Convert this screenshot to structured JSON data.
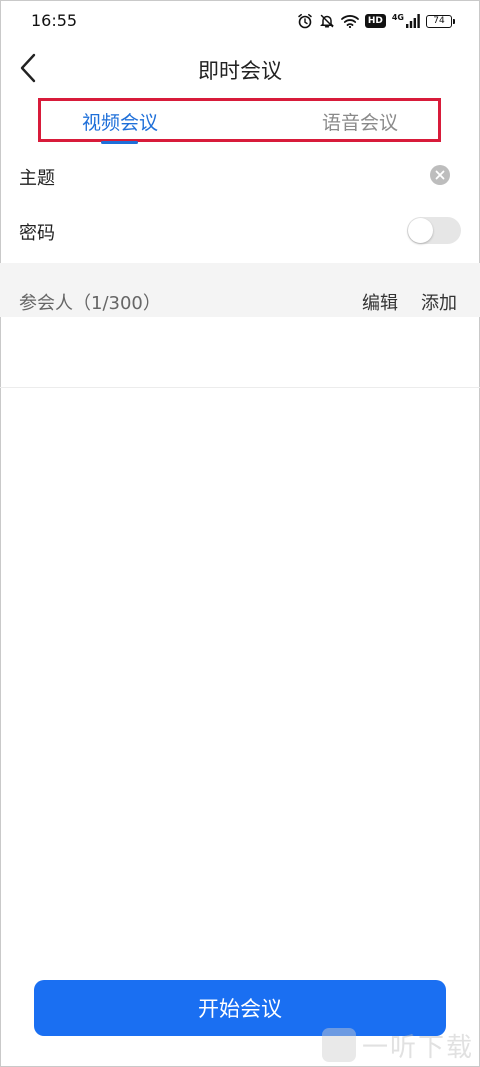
{
  "status_bar": {
    "time": "16:55",
    "hd_label": "HD",
    "network_label": "4G",
    "battery_level": "74",
    "icons": [
      "alarm-icon",
      "bell-off-icon",
      "wifi-icon",
      "hd-icon",
      "signal-icon",
      "battery-icon"
    ]
  },
  "header": {
    "title": "即时会议",
    "back_icon": "chevron-left-icon"
  },
  "tabs": [
    {
      "label": "视频会议",
      "active": true
    },
    {
      "label": "语音会议",
      "active": false
    }
  ],
  "form": {
    "subject_label": "主题",
    "subject_value": "",
    "password_label": "密码",
    "password_enabled": false
  },
  "participants": {
    "label": "参会人（1/300）",
    "edit_label": "编辑",
    "add_label": "添加"
  },
  "start_button_label": "开始会议",
  "watermark": {
    "text": "一听下载"
  },
  "colors": {
    "accent": "#1a6ff2",
    "tab_active": "#1e6fd9",
    "tab_inactive": "#8a8a8a",
    "highlight_box": "#d81b3a"
  }
}
